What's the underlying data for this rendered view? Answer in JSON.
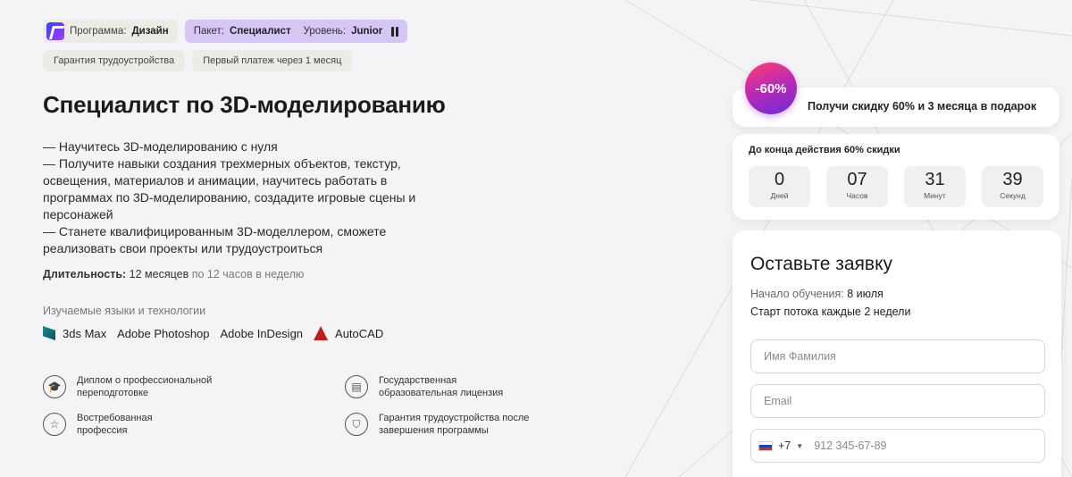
{
  "tags": {
    "program_label": "Программа:",
    "program_value": "Дизайн",
    "package_label": "Пакет:",
    "package_value": "Специалист",
    "level_label": "Уровень:",
    "level_value": "Junior",
    "guarantee": "Гарантия трудоустройства",
    "first_payment": "Первый платеж через 1 месяц"
  },
  "title": "Специалист по 3D-моделированию",
  "description": [
    "— Научитесь 3D-моделированию с нуля",
    "— Получите навыки создания трехмерных объектов, текстур, освещения, материалов и анимации, научитесь работать в программах по 3D-моделированию, создадите игровые сцены и персонажей",
    "— Станете квалифицированным 3D-моделлером, сможете реализовать свои проекты или трудоустроиться"
  ],
  "duration": {
    "label": "Длительность:",
    "value": "12 месяцев",
    "extra": "по 12 часов в неделю"
  },
  "tech": {
    "title": "Изучаемые языки и технологии",
    "items": [
      "3ds Max",
      "Adobe Photoshop",
      "Adobe InDesign",
      "AutoCAD"
    ]
  },
  "features": [
    {
      "text": "Диплом о профессиональной переподготовке",
      "icon": "graduation-cap-icon"
    },
    {
      "text": "Государственная образовательная лицензия",
      "icon": "clipboard-icon"
    },
    {
      "text": "Востребованная профессия",
      "icon": "star-icon"
    },
    {
      "text": "Гарантия трудоустройства после завершения программы",
      "icon": "shield-icon"
    }
  ],
  "promo": {
    "badge": "-60%",
    "text": "Получи скидку 60% и 3 месяца в подарок"
  },
  "timer": {
    "title": "До конца действия 60% скидки",
    "units": [
      {
        "value": "0",
        "label": "Дней"
      },
      {
        "value": "07",
        "label": "Часов"
      },
      {
        "value": "31",
        "label": "Минут"
      },
      {
        "value": "39",
        "label": "Секунд"
      }
    ]
  },
  "form": {
    "title": "Оставьте заявку",
    "start_label": "Начало обучения:",
    "start_value": "8 июля",
    "every": "Старт потока каждые 2 недели",
    "name_placeholder": "Имя Фамилия",
    "email_placeholder": "Email",
    "phone_code": "+7",
    "phone_placeholder": "912 345-67-89"
  },
  "colors": {
    "package_tag": "#d5c6f6",
    "badge_gradient_start": "#ff3e6c",
    "badge_gradient_end": "#6a2bd6"
  }
}
